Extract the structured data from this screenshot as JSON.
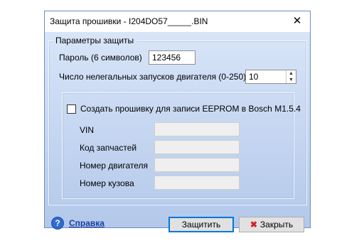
{
  "window": {
    "title": "Защита прошивки - I204DO57_____.BIN",
    "close_glyph": "✕"
  },
  "protection": {
    "legend": "Параметры защиты",
    "password_label": "Пароль (6 символов)",
    "password_value": "123456",
    "illegal_starts_label": "Число нелегальных запусков двигателя (0-250)",
    "illegal_starts_value": "10"
  },
  "eeprom": {
    "checkbox_label": "Создать прошивку для записи EEPROM в Bosch M1.5.4",
    "checked": false,
    "fields": [
      {
        "label": "VIN",
        "value": ""
      },
      {
        "label": "Код запчастей",
        "value": ""
      },
      {
        "label": "Номер двигателя",
        "value": ""
      },
      {
        "label": "Номер кузова",
        "value": ""
      }
    ]
  },
  "footer": {
    "help_icon": "?",
    "help_label": "Справка",
    "protect_label": "Защитить",
    "close_label": "Закрыть",
    "close_icon": "✖"
  },
  "colors": {
    "client_gradient_top": "#d8e5f8",
    "client_gradient_bottom": "#b3c8ea",
    "help_link": "#1a3da0",
    "close_icon": "#d42020"
  }
}
